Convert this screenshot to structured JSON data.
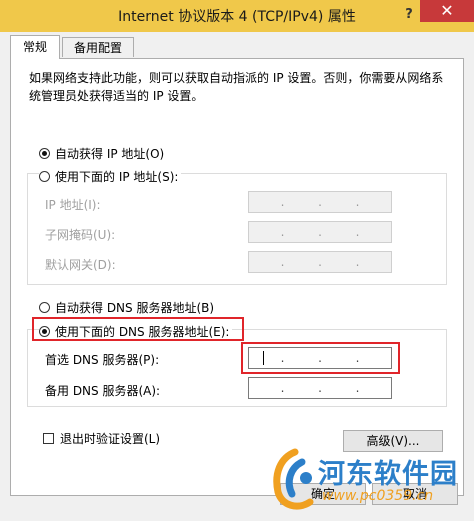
{
  "window": {
    "title": "Internet 协议版本 4 (TCP/IPv4) 属性",
    "help_label": "?",
    "close_label": "✕"
  },
  "tabs": [
    {
      "label": "常规",
      "active": true
    },
    {
      "label": "备用配置",
      "active": false
    }
  ],
  "intro_text": "如果网络支持此功能，则可以获取自动指派的 IP 设置。否则，你需要从网络系统管理员处获得适当的 IP 设置。",
  "ip_section": {
    "auto_label": "自动获得 IP 地址(O)",
    "manual_label": "使用下面的 IP 地址(S):",
    "selected": "auto",
    "fields": [
      {
        "label": "IP 地址(I):",
        "value": ". . ."
      },
      {
        "label": "子网掩码(U):",
        "value": ". . ."
      },
      {
        "label": "默认网关(D):",
        "value": ". . ."
      }
    ]
  },
  "dns_section": {
    "auto_label": "自动获得 DNS 服务器地址(B)",
    "manual_label": "使用下面的 DNS 服务器地址(E):",
    "selected": "manual",
    "preferred_label": "首选 DNS 服务器(P):",
    "alternate_label": "备用 DNS 服务器(A):"
  },
  "validate_label": "退出时验证设置(L)",
  "advanced_label": "高级(V)...",
  "ok_label": "确定",
  "cancel_label": "取消",
  "watermark": {
    "name": "河东软件园",
    "url": "www.pc0359.cn"
  },
  "colors": {
    "titlebar": "#f0c84a",
    "close": "#c7393a",
    "highlight": "#e0252a",
    "watermark_blue": "#2c7fc9",
    "watermark_orange": "#f0a020"
  }
}
